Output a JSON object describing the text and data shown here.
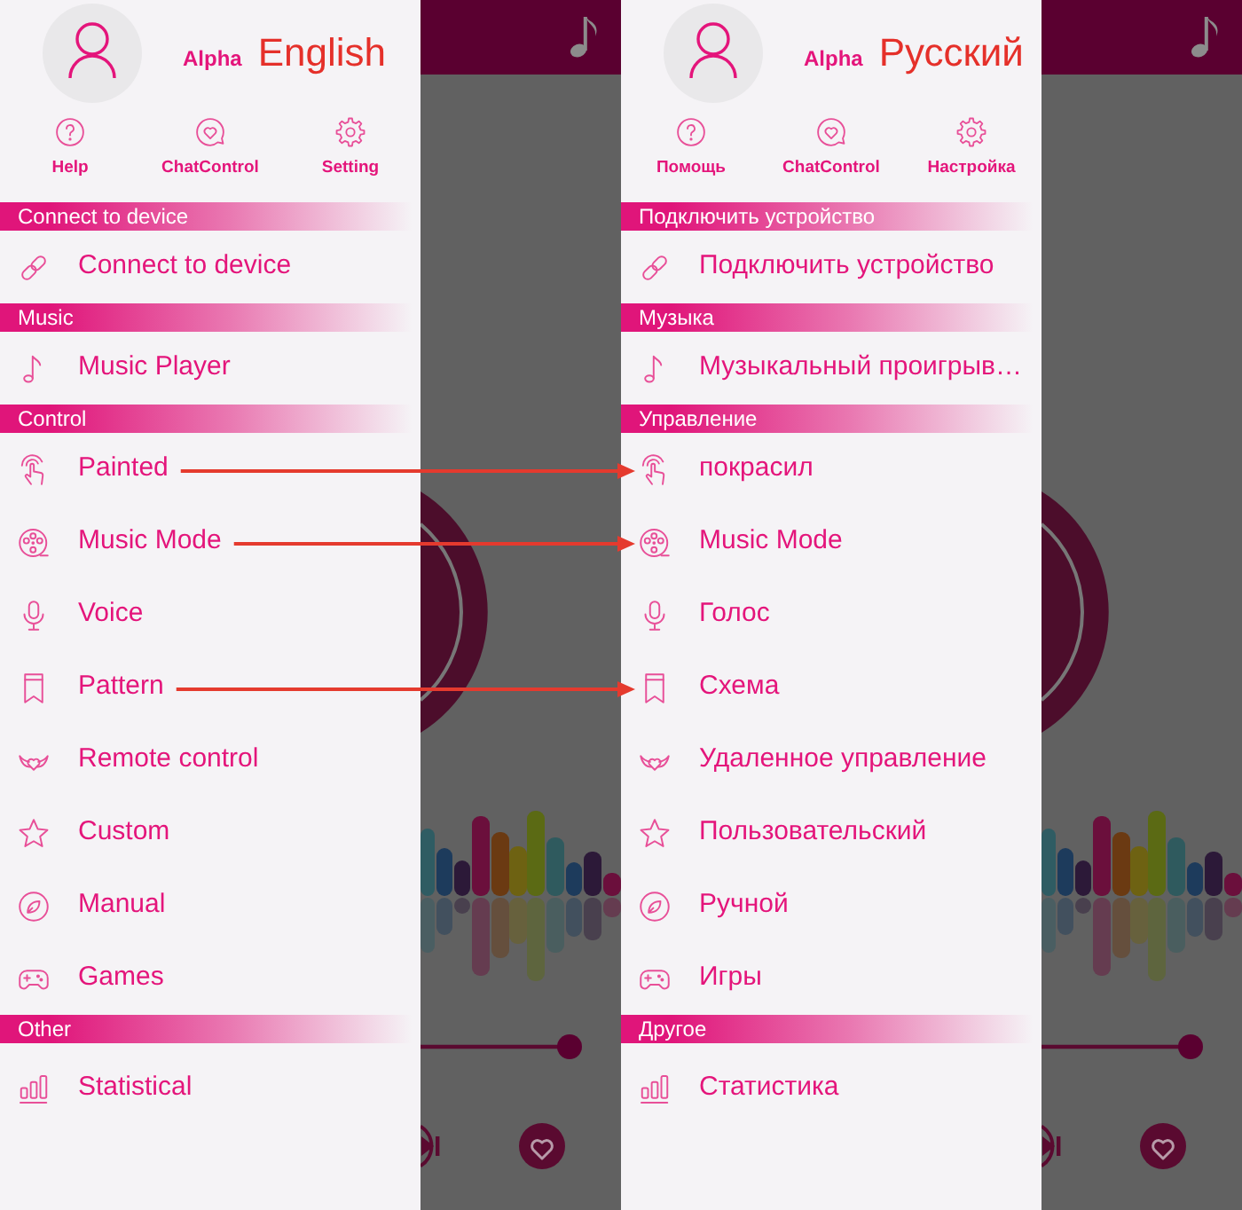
{
  "screens": [
    {
      "drawer": {
        "user_name": "Alpha",
        "language": "English",
        "actions": [
          "Help",
          "ChatControl",
          "Setting"
        ],
        "sections": [
          {
            "title": "Connect to device",
            "items": [
              {
                "label": "Connect to device",
                "arrow": false
              }
            ]
          },
          {
            "title": "Music",
            "items": [
              {
                "label": "Music Player",
                "arrow": false
              }
            ]
          },
          {
            "title": "Control",
            "items": [
              {
                "label": "Painted",
                "arrow": true
              },
              {
                "label": "Music Mode",
                "arrow": true
              },
              {
                "label": "Voice",
                "arrow": false
              },
              {
                "label": "Pattern",
                "arrow": true
              },
              {
                "label": "Remote control",
                "arrow": false
              },
              {
                "label": "Custom",
                "arrow": false
              },
              {
                "label": "Manual",
                "arrow": false
              },
              {
                "label": "Games",
                "arrow": false
              }
            ]
          },
          {
            "title": "Other",
            "items": [
              {
                "label": "Statistical",
                "arrow": false
              }
            ]
          }
        ]
      }
    },
    {
      "drawer": {
        "user_name": "Alpha",
        "language": "Русский",
        "actions": [
          "Помощь",
          "ChatControl",
          "Настройка"
        ],
        "sections": [
          {
            "title": "Подключить устройство",
            "items": [
              {
                "label": "Подключить устройство",
                "arrow": false
              }
            ]
          },
          {
            "title": "Музыка",
            "items": [
              {
                "label": "Музыкальный проигрыв…",
                "arrow": false
              }
            ]
          },
          {
            "title": "Управление",
            "items": [
              {
                "label": "покрасил",
                "arrow": true
              },
              {
                "label": "Music Mode",
                "arrow": true
              },
              {
                "label": "Голос",
                "arrow": false
              },
              {
                "label": "Схема",
                "arrow": true
              },
              {
                "label": "Удаленное управление",
                "arrow": false
              },
              {
                "label": "Пользовательский",
                "arrow": false
              },
              {
                "label": "Ручной",
                "arrow": false
              },
              {
                "label": "Игры",
                "arrow": false
              }
            ]
          },
          {
            "title": "Другое",
            "items": [
              {
                "label": "Статистика",
                "arrow": false
              }
            ]
          }
        ]
      }
    }
  ]
}
